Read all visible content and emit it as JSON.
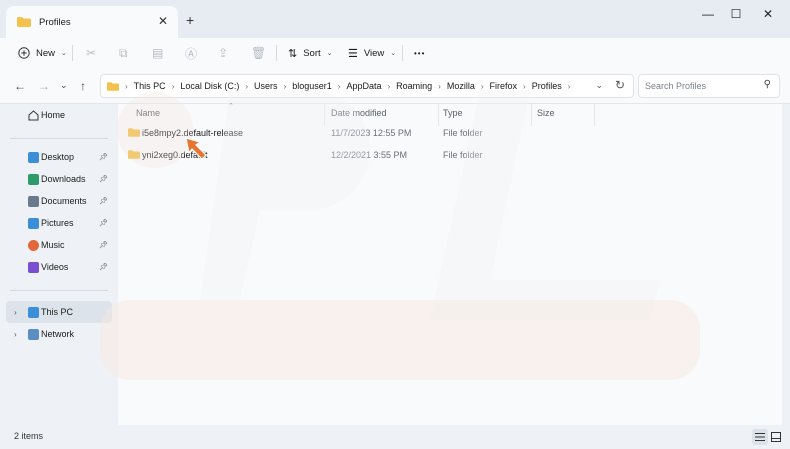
{
  "tab": {
    "title": "Profiles",
    "close": "✕",
    "new_tab": "+"
  },
  "window_controls": {
    "minimize": "—",
    "maximize": "☐",
    "close": "✕"
  },
  "toolbar": {
    "new_label": "New",
    "sort_label": "Sort",
    "view_label": "View",
    "more": "•••"
  },
  "address": {
    "crumbs": [
      "This PC",
      "Local Disk (C:)",
      "Users",
      "bloguser1",
      "AppData",
      "Roaming",
      "Mozilla",
      "Firefox",
      "Profiles"
    ],
    "separator": "›"
  },
  "search": {
    "placeholder": "Search Profiles"
  },
  "sidebar": {
    "home": "Home",
    "quick": [
      {
        "label": "Desktop",
        "icon": "desktop-icon",
        "color": "#3a8fd8"
      },
      {
        "label": "Downloads",
        "icon": "downloads-icon",
        "color": "#2f9b6a"
      },
      {
        "label": "Documents",
        "icon": "documents-icon",
        "color": "#6a7a8c"
      },
      {
        "label": "Pictures",
        "icon": "pictures-icon",
        "color": "#3a8fd8"
      },
      {
        "label": "Music",
        "icon": "music-icon",
        "color": "#e2673a"
      },
      {
        "label": "Videos",
        "icon": "videos-icon",
        "color": "#7a4fcf"
      }
    ],
    "this_pc": "This PC",
    "network": "Network"
  },
  "columns": {
    "name": "Name",
    "date": "Date modified",
    "type": "Type",
    "size": "Size"
  },
  "files": [
    {
      "name": "i5e8mpy2.default-release",
      "date": "11/7/2023 12:55 PM",
      "type": "File folder",
      "size": ""
    },
    {
      "name": "yni2xeg0.default",
      "date": "12/2/2021 3:55 PM",
      "type": "File folder",
      "size": ""
    }
  ],
  "status": {
    "count": "2 items"
  },
  "colors": {
    "accent": "#0067c0",
    "folder": "#f2c14e",
    "cursor": "#e8742f"
  }
}
